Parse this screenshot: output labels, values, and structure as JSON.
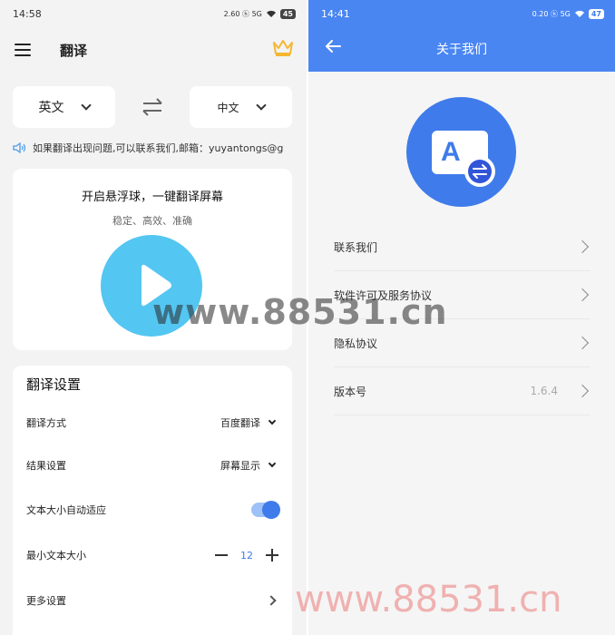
{
  "left": {
    "status": {
      "time": "14:58",
      "icons": "2.60 ⓗ 5G",
      "battery": "45"
    },
    "appbar": {
      "title": "翻译",
      "menu_icon": "hamburger-icon",
      "vip_icon": "crown-icon"
    },
    "languages": {
      "from": "英文",
      "to": "中文",
      "swap_icon": "swap-arrows-icon"
    },
    "notice": {
      "text": "如果翻译出现问题,可以联系我们,邮箱：yuyantongs@g",
      "icon": "speaker-icon"
    },
    "float_card": {
      "title": "开启悬浮球，一键翻译屏幕",
      "subtitle": "稳定、高效、准确",
      "play_icon": "play-icon"
    },
    "settings": {
      "title": "翻译设置",
      "mode_label": "翻译方式",
      "mode_value": "百度翻译",
      "result_label": "结果设置",
      "result_value": "屏幕显示",
      "autosize_label": "文本大小自动适应",
      "autosize_on": true,
      "minsize_label": "最小文本大小",
      "minsize_value": "12",
      "more_label": "更多设置"
    }
  },
  "right": {
    "status": {
      "time": "14:41",
      "icons": "0.20 ⓗ 5G",
      "battery": "47"
    },
    "header": {
      "title": "关于我们",
      "back_icon": "back-arrow-icon"
    },
    "logo": {
      "letter": "A",
      "icon": "translate-app-logo-icon"
    },
    "menu": [
      {
        "label": "联系我们",
        "value": ""
      },
      {
        "label": "软件许可及服务协议",
        "value": ""
      },
      {
        "label": "隐私协议",
        "value": ""
      },
      {
        "label": "版本号",
        "value": "1.6.4"
      }
    ]
  },
  "watermark": {
    "text": "www.88531.cn"
  },
  "colors": {
    "accent": "#3f7bea",
    "header": "#4a86f2",
    "play": "#54c6f2",
    "crown": "#f5b731"
  }
}
